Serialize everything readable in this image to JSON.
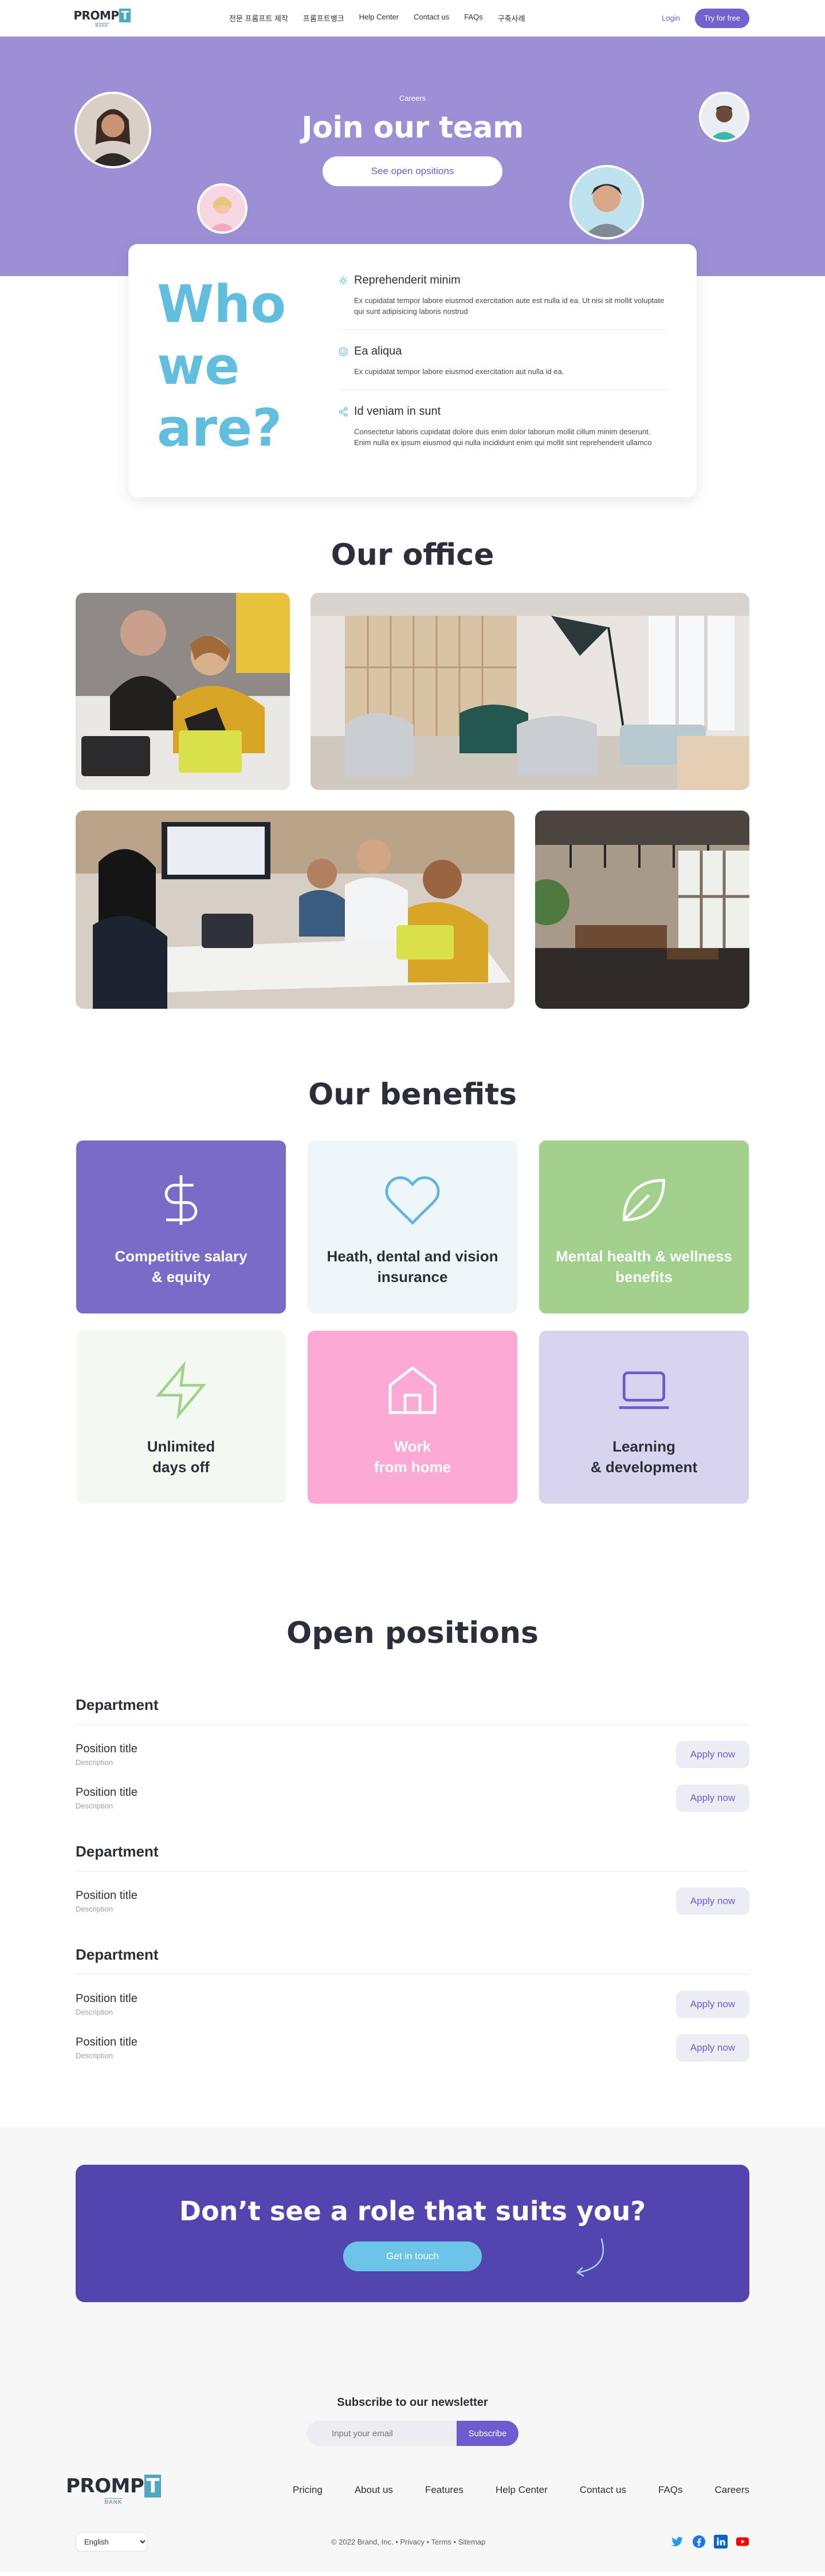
{
  "nav": {
    "logo_main": "PROMP",
    "logo_accent": "T",
    "logo_sub": "BANK",
    "links": [
      "전문 프롬프트 제작",
      "프롬프트뱅크",
      "Help Center",
      "Contact us",
      "FAQs",
      "구축사례"
    ],
    "login": "Login",
    "try": "Try for free"
  },
  "hero": {
    "eyebrow": "Careers",
    "title": "Join our team",
    "button": "See open opsitions"
  },
  "who": {
    "title": "Who\nwe\nare?",
    "items": [
      {
        "icon": "sun-icon",
        "heading": "Reprehenderit minim",
        "text": "Ex cupidatat tempor labore eiusmod exercitation aute est nulla id ea. Ut nisi sit mollit voluptate qui sunt adipisicing laboris nostrud"
      },
      {
        "icon": "smile-icon",
        "heading": "Ea aliqua",
        "text": "Ex cupidatat tempor labore eiusmod exercitation aut nulla id ea."
      },
      {
        "icon": "share-icon",
        "heading": "Id veniam in sunt",
        "text": "Consectetur laboris cupidatat dolore duis enim dolor laborum mollit cillum minim deserunt. Enim nulla ex ipsum eiusmod qui nulla incididunt enim qui mollit sint reprehenderit ullamco"
      }
    ]
  },
  "office": {
    "title": "Our office"
  },
  "benefits": {
    "title": "Our benefits",
    "items": [
      {
        "icon": "dollar-icon",
        "label": "Competitive salary\n& equity",
        "bg": "#7a6bc9",
        "fg": "#ffffff",
        "icon_color": "#ffffff"
      },
      {
        "icon": "heart-icon",
        "label": "Heath, dental and vision\ninsurance",
        "bg": "#eef6fa",
        "fg": "#2b2f3a",
        "icon_color": "#5fb8da"
      },
      {
        "icon": "leaf-icon",
        "label": "Mental health & wellness\nbenefits",
        "bg": "#a1cf8c",
        "fg": "#ffffff",
        "icon_color": "#ffffff"
      },
      {
        "icon": "lightning-icon",
        "label": "Unlimited\ndays off",
        "bg": "#f3f9f0",
        "fg": "#2b2f3a",
        "icon_color": "#9fd28b"
      },
      {
        "icon": "home-icon",
        "label": "Work\nfrom home",
        "bg": "#fbaad6",
        "fg": "#ffffff",
        "icon_color": "#ffffff"
      },
      {
        "icon": "laptop-icon",
        "label": "Learning\n& development",
        "bg": "#d9d4ed",
        "fg": "#2b2f3a",
        "icon_color": "#6d5bd0"
      }
    ]
  },
  "positions": {
    "title": "Open positions",
    "apply_label": "Apply now",
    "departments": [
      {
        "name": "Department",
        "roles": [
          {
            "title": "Position title",
            "desc": "Description"
          },
          {
            "title": "Position title",
            "desc": "Description"
          }
        ]
      },
      {
        "name": "Department",
        "roles": [
          {
            "title": "Position title",
            "desc": "Description"
          }
        ]
      },
      {
        "name": "Department",
        "roles": [
          {
            "title": "Position title",
            "desc": "Description"
          },
          {
            "title": "Position title",
            "desc": "Description"
          }
        ]
      }
    ]
  },
  "cta": {
    "title": "Don’t see a role that suits you?",
    "button": "Get in touch"
  },
  "newsletter": {
    "title": "Subscribe to our newsletter",
    "placeholder": "Input your email",
    "button": "Subscribe"
  },
  "footer": {
    "links": [
      "Pricing",
      "About us",
      "Features",
      "Help Center",
      "Contact us",
      "FAQs",
      "Careers"
    ],
    "language": "English",
    "copyright": "© 2022 Brand, Inc. • Privacy • Terms • Sitemap",
    "socials": [
      "twitter-icon",
      "facebook-icon",
      "linkedin-icon",
      "youtube-icon"
    ]
  },
  "colors": {
    "hero_bg": "#9d8fd6",
    "primary": "#6d5bd0",
    "cta_bg": "#5245b0",
    "accent_blue": "#62bede"
  }
}
